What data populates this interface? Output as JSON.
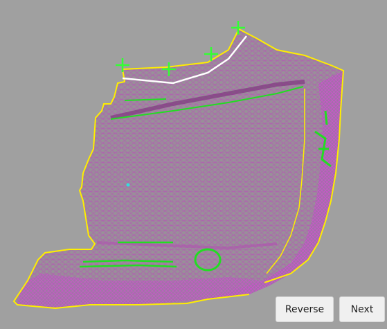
{
  "buttons": {
    "reverse_label": "Reverse",
    "next_label": "Next"
  },
  "colors": {
    "background": "#a0a0a0",
    "mesh_fill": "#9a8a9a",
    "mesh_line": "#c040c0",
    "boundary": "#ffee00",
    "curve": "#ffffff",
    "control_point": "#33ff33",
    "feature_line": "#22dd22"
  },
  "viewport": {
    "icons": [
      "mesh-model",
      "control-point-icon",
      "selected-curve"
    ]
  }
}
